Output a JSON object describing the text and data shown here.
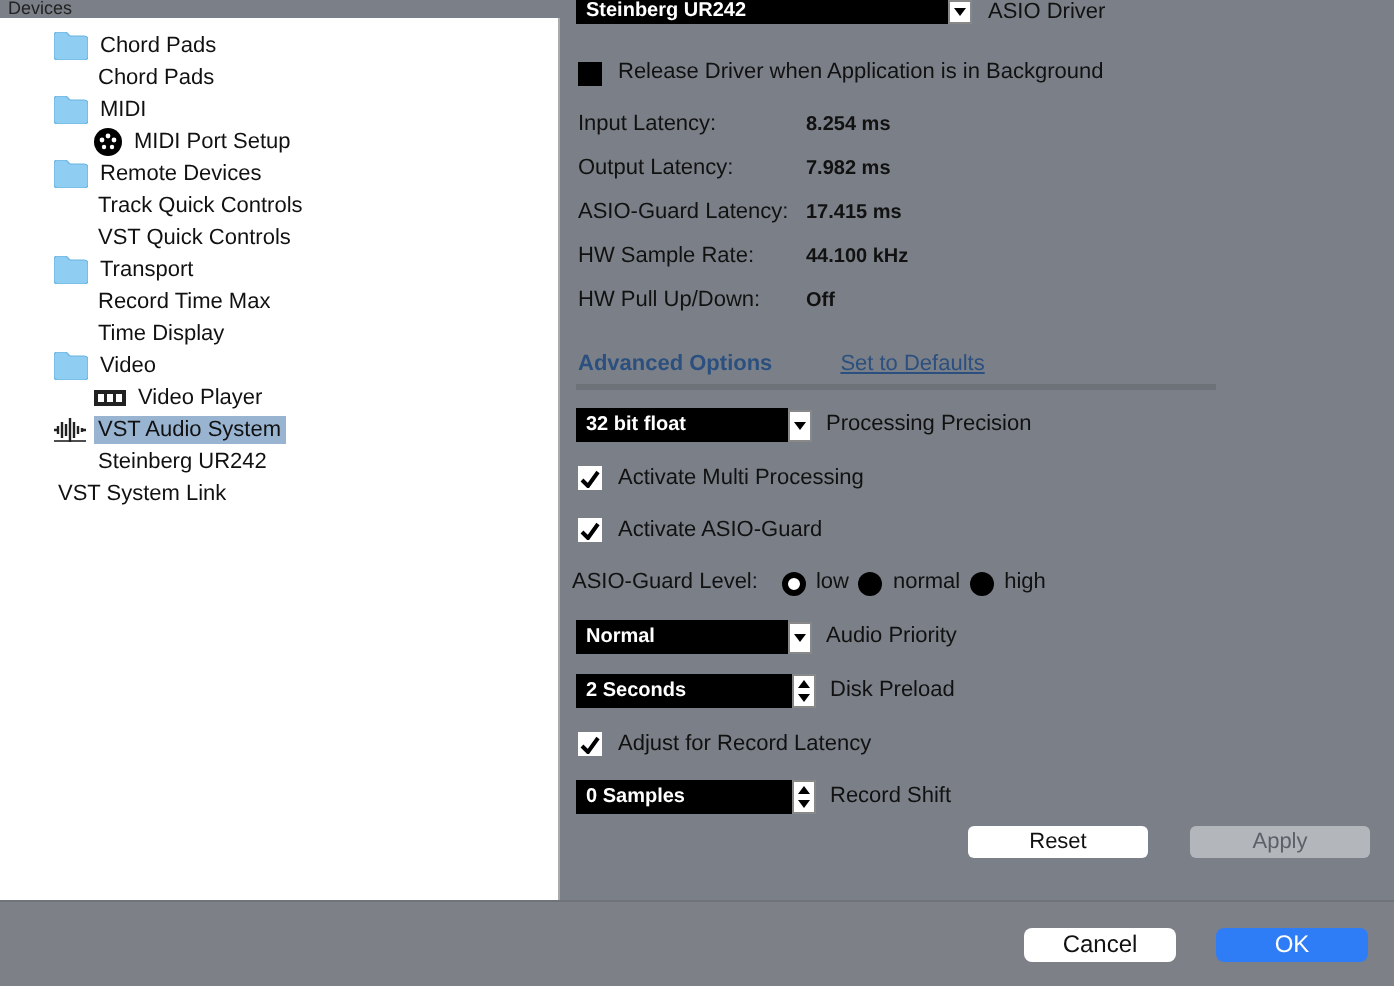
{
  "sidebar": {
    "title": "Devices",
    "tree": [
      {
        "label": "Chord Pads",
        "kind": "folder",
        "selected": false,
        "children": [
          {
            "label": "Chord Pads",
            "selected": false
          }
        ]
      },
      {
        "label": "MIDI",
        "kind": "folder",
        "selected": false,
        "children": [
          {
            "label": "MIDI Port Setup",
            "kind": "midi",
            "selected": false
          }
        ]
      },
      {
        "label": "Remote Devices",
        "kind": "folder",
        "selected": false,
        "children": [
          {
            "label": "Track Quick Controls",
            "selected": false
          },
          {
            "label": "VST Quick Controls",
            "selected": false
          }
        ]
      },
      {
        "label": "Transport",
        "kind": "folder",
        "selected": false,
        "children": [
          {
            "label": "Record Time Max",
            "selected": false
          },
          {
            "label": "Time Display",
            "selected": false
          }
        ]
      },
      {
        "label": "Video",
        "kind": "folder",
        "selected": false,
        "children": [
          {
            "label": "Video Player",
            "kind": "video",
            "selected": false
          }
        ]
      },
      {
        "label": "VST Audio System",
        "kind": "audio",
        "selected": true,
        "children": [
          {
            "label": "Steinberg UR242",
            "selected": false
          }
        ]
      },
      {
        "label": "VST System Link",
        "selected": false
      }
    ]
  },
  "driver": {
    "value": "Steinberg UR242",
    "label": "ASIO Driver"
  },
  "release_driver": {
    "label": "Release Driver when Application is in Background",
    "checked": false
  },
  "info": [
    {
      "label": "Input Latency:",
      "value": "8.254 ms"
    },
    {
      "label": "Output Latency:",
      "value": "7.982 ms"
    },
    {
      "label": "ASIO-Guard Latency:",
      "value": "17.415 ms"
    },
    {
      "label": "HW Sample Rate:",
      "value": "44.100 kHz"
    },
    {
      "label": "HW Pull Up/Down:",
      "value": "Off"
    }
  ],
  "advanced_options": "Advanced Options",
  "set_to_defaults": "Set to Defaults",
  "settings": [
    {
      "kind": "select",
      "selection": "32 bit float",
      "caption": "Processing Precision"
    },
    {
      "kind": "checkbox",
      "label": "Activate Multi Processing",
      "checked": true
    },
    {
      "kind": "checkbox",
      "label": "Activate ASIO-Guard",
      "checked": true
    },
    {
      "kind": "radio",
      "label": "ASIO-Guard Level:",
      "options": [
        {
          "label": "low",
          "selected": true
        },
        {
          "label": "normal",
          "selected": false
        },
        {
          "label": "high",
          "selected": false
        }
      ]
    },
    {
      "kind": "select",
      "selection": "Normal",
      "caption": "Audio Priority"
    },
    {
      "kind": "spinner",
      "selection": "2 Seconds",
      "caption": "Disk Preload"
    },
    {
      "kind": "checkbox",
      "label": "Adjust for Record Latency",
      "checked": true
    },
    {
      "kind": "spinner",
      "selection": "0 Samples",
      "caption": "Record Shift"
    }
  ],
  "panel_buttons": [
    {
      "label": "Reset",
      "disabled": false
    },
    {
      "label": "Apply",
      "disabled": true
    }
  ],
  "dialog_buttons": [
    {
      "label": "Cancel",
      "primary": false
    },
    {
      "label": "OK",
      "primary": true
    }
  ]
}
